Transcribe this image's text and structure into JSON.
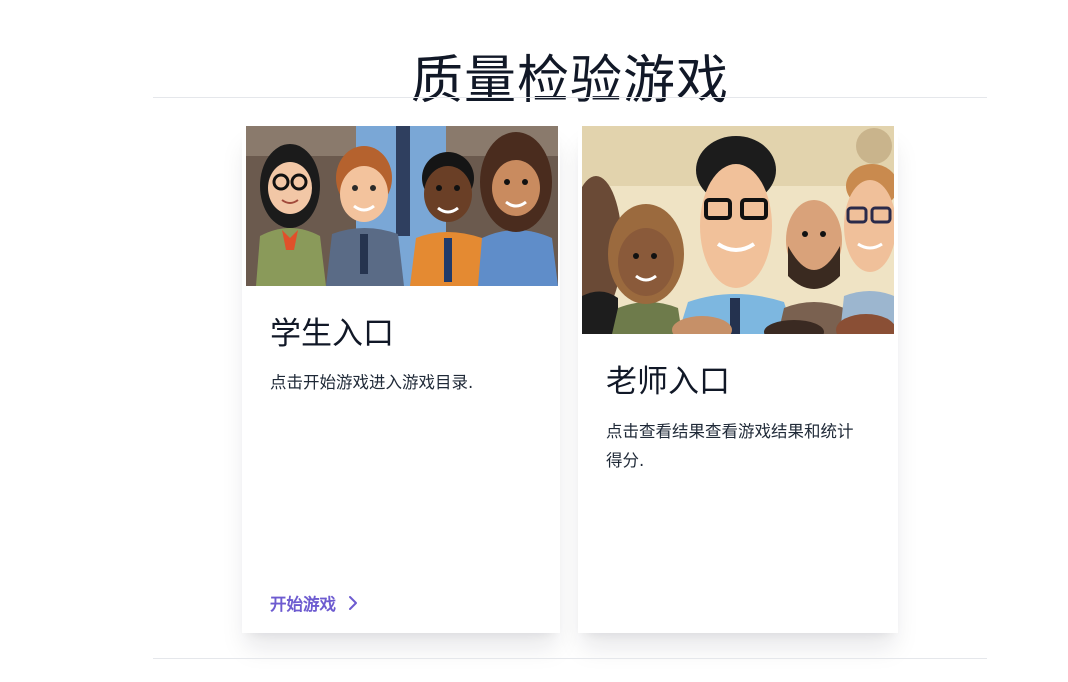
{
  "page": {
    "title": "质量检验游戏"
  },
  "cards": [
    {
      "id": "student",
      "title": "学生入口",
      "description": "点击开始游戏进入游戏目录.",
      "link_label": "开始游戏",
      "link_icon": "chevron-right-icon",
      "image": "cartoon-group-of-students"
    },
    {
      "id": "teacher",
      "title": "老师入口",
      "description": "点击查看结果查看游戏结果和统计得分.",
      "image": "cartoon-group-of-teachers"
    }
  ],
  "colors": {
    "accent": "#6d5bd0",
    "heading": "#111827",
    "divider": "#e5e7eb"
  }
}
